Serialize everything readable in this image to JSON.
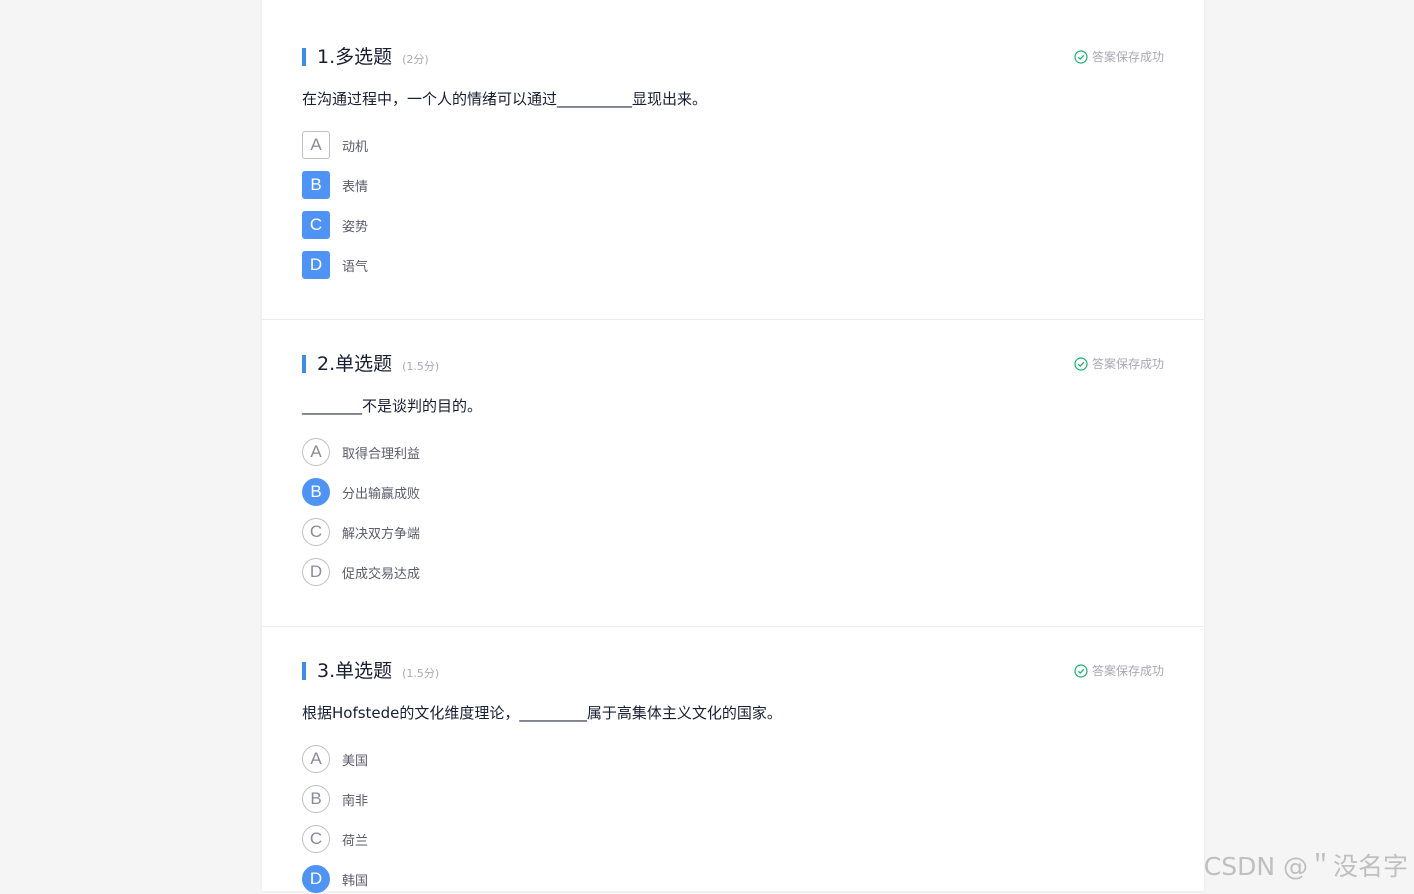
{
  "status_text": "答案保存成功",
  "questions": [
    {
      "title": "1.多选题",
      "score": "(2分)",
      "stem": "在沟通过程中，一个人的情绪可以通过__________显现出来。",
      "options": [
        {
          "letter": "A",
          "text": "动机",
          "selected": false
        },
        {
          "letter": "B",
          "text": "表情",
          "selected": true
        },
        {
          "letter": "C",
          "text": "姿势",
          "selected": true
        },
        {
          "letter": "D",
          "text": "语气",
          "selected": true
        }
      ]
    },
    {
      "title": "2.单选题",
      "score": "(1.5分)",
      "stem": "________不是谈判的目的。",
      "options": [
        {
          "letter": "A",
          "text": "取得合理利益",
          "selected": false
        },
        {
          "letter": "B",
          "text": "分出输赢成败",
          "selected": true
        },
        {
          "letter": "C",
          "text": "解决双方争端",
          "selected": false
        },
        {
          "letter": "D",
          "text": "促成交易达成",
          "selected": false
        }
      ]
    },
    {
      "title": "3.单选题",
      "score": "(1.5分)",
      "stem": "根据Hofstede的文化维度理论，_________属于高集体主义文化的国家。",
      "options": [
        {
          "letter": "A",
          "text": "美国",
          "selected": false
        },
        {
          "letter": "B",
          "text": "南非",
          "selected": false
        },
        {
          "letter": "C",
          "text": "荷兰",
          "selected": false
        },
        {
          "letter": "D",
          "text": "韩国",
          "selected": true
        }
      ]
    }
  ],
  "watermark": "CSDN @＂没名字",
  "colors": {
    "accent": "#4f94f5",
    "title_bar": "#3a8ee6",
    "saved_icon": "#19b36b"
  }
}
